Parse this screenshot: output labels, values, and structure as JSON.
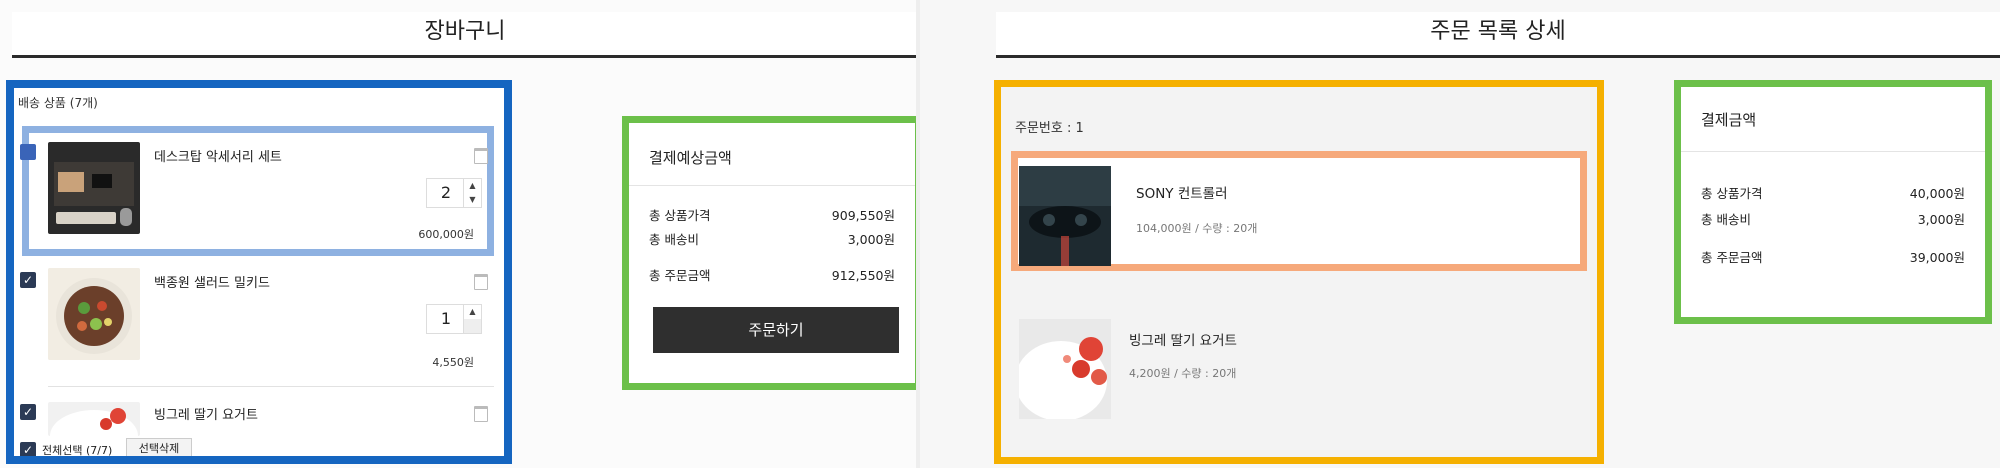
{
  "cart": {
    "title": "장바구니",
    "header": "배송 상품 (7개)",
    "items": [
      {
        "name": "데스크탑 악세서리 세트",
        "qty": "2",
        "price": "600,000원",
        "thumb": "desk-accessory-photo"
      },
      {
        "name": "백종원 샐러드 밀키드",
        "qty": "1",
        "price": "4,550원",
        "thumb": "salad-photo"
      },
      {
        "name": "빙그레 딸기 요거트",
        "thumb": "strawberry-yogurt-photo"
      }
    ],
    "footer": {
      "select_all": "전체선택 (7/7)",
      "delete_selected": "선택삭제"
    },
    "summary": {
      "title": "결제예상금액",
      "rows": [
        {
          "label": "총 상품가격",
          "value": "909,550원"
        },
        {
          "label": "총 배송비",
          "value": "3,000원"
        },
        {
          "label": "총 주문금액",
          "value": "912,550원"
        }
      ],
      "order_button": "주문하기"
    }
  },
  "order": {
    "title": "주문 목록 상세",
    "order_no": "주문번호 : 1",
    "items": [
      {
        "name": "SONY 컨트롤러",
        "meta": "104,000원 / 수량 : 20개",
        "thumb": "controller-photo"
      },
      {
        "name": "빙그레 딸기 요거트",
        "meta": "4,200원 / 수량 : 20개",
        "thumb": "strawberry-yogurt-photo"
      }
    ],
    "summary": {
      "title": "결제금액",
      "rows": [
        {
          "label": "총 상품가격",
          "value": "40,000원"
        },
        {
          "label": "총 배송비",
          "value": "3,000원"
        },
        {
          "label": "총 주문금액",
          "value": "39,000원"
        }
      ]
    }
  },
  "colors": {
    "cart_box": "#1565c0",
    "item_highlight": "#8eb1e1",
    "summary_box": "#6cc04a",
    "order_box": "#f5b000",
    "order_item_highlight": "#f6a97b",
    "order_button": "#2f2f2f"
  }
}
